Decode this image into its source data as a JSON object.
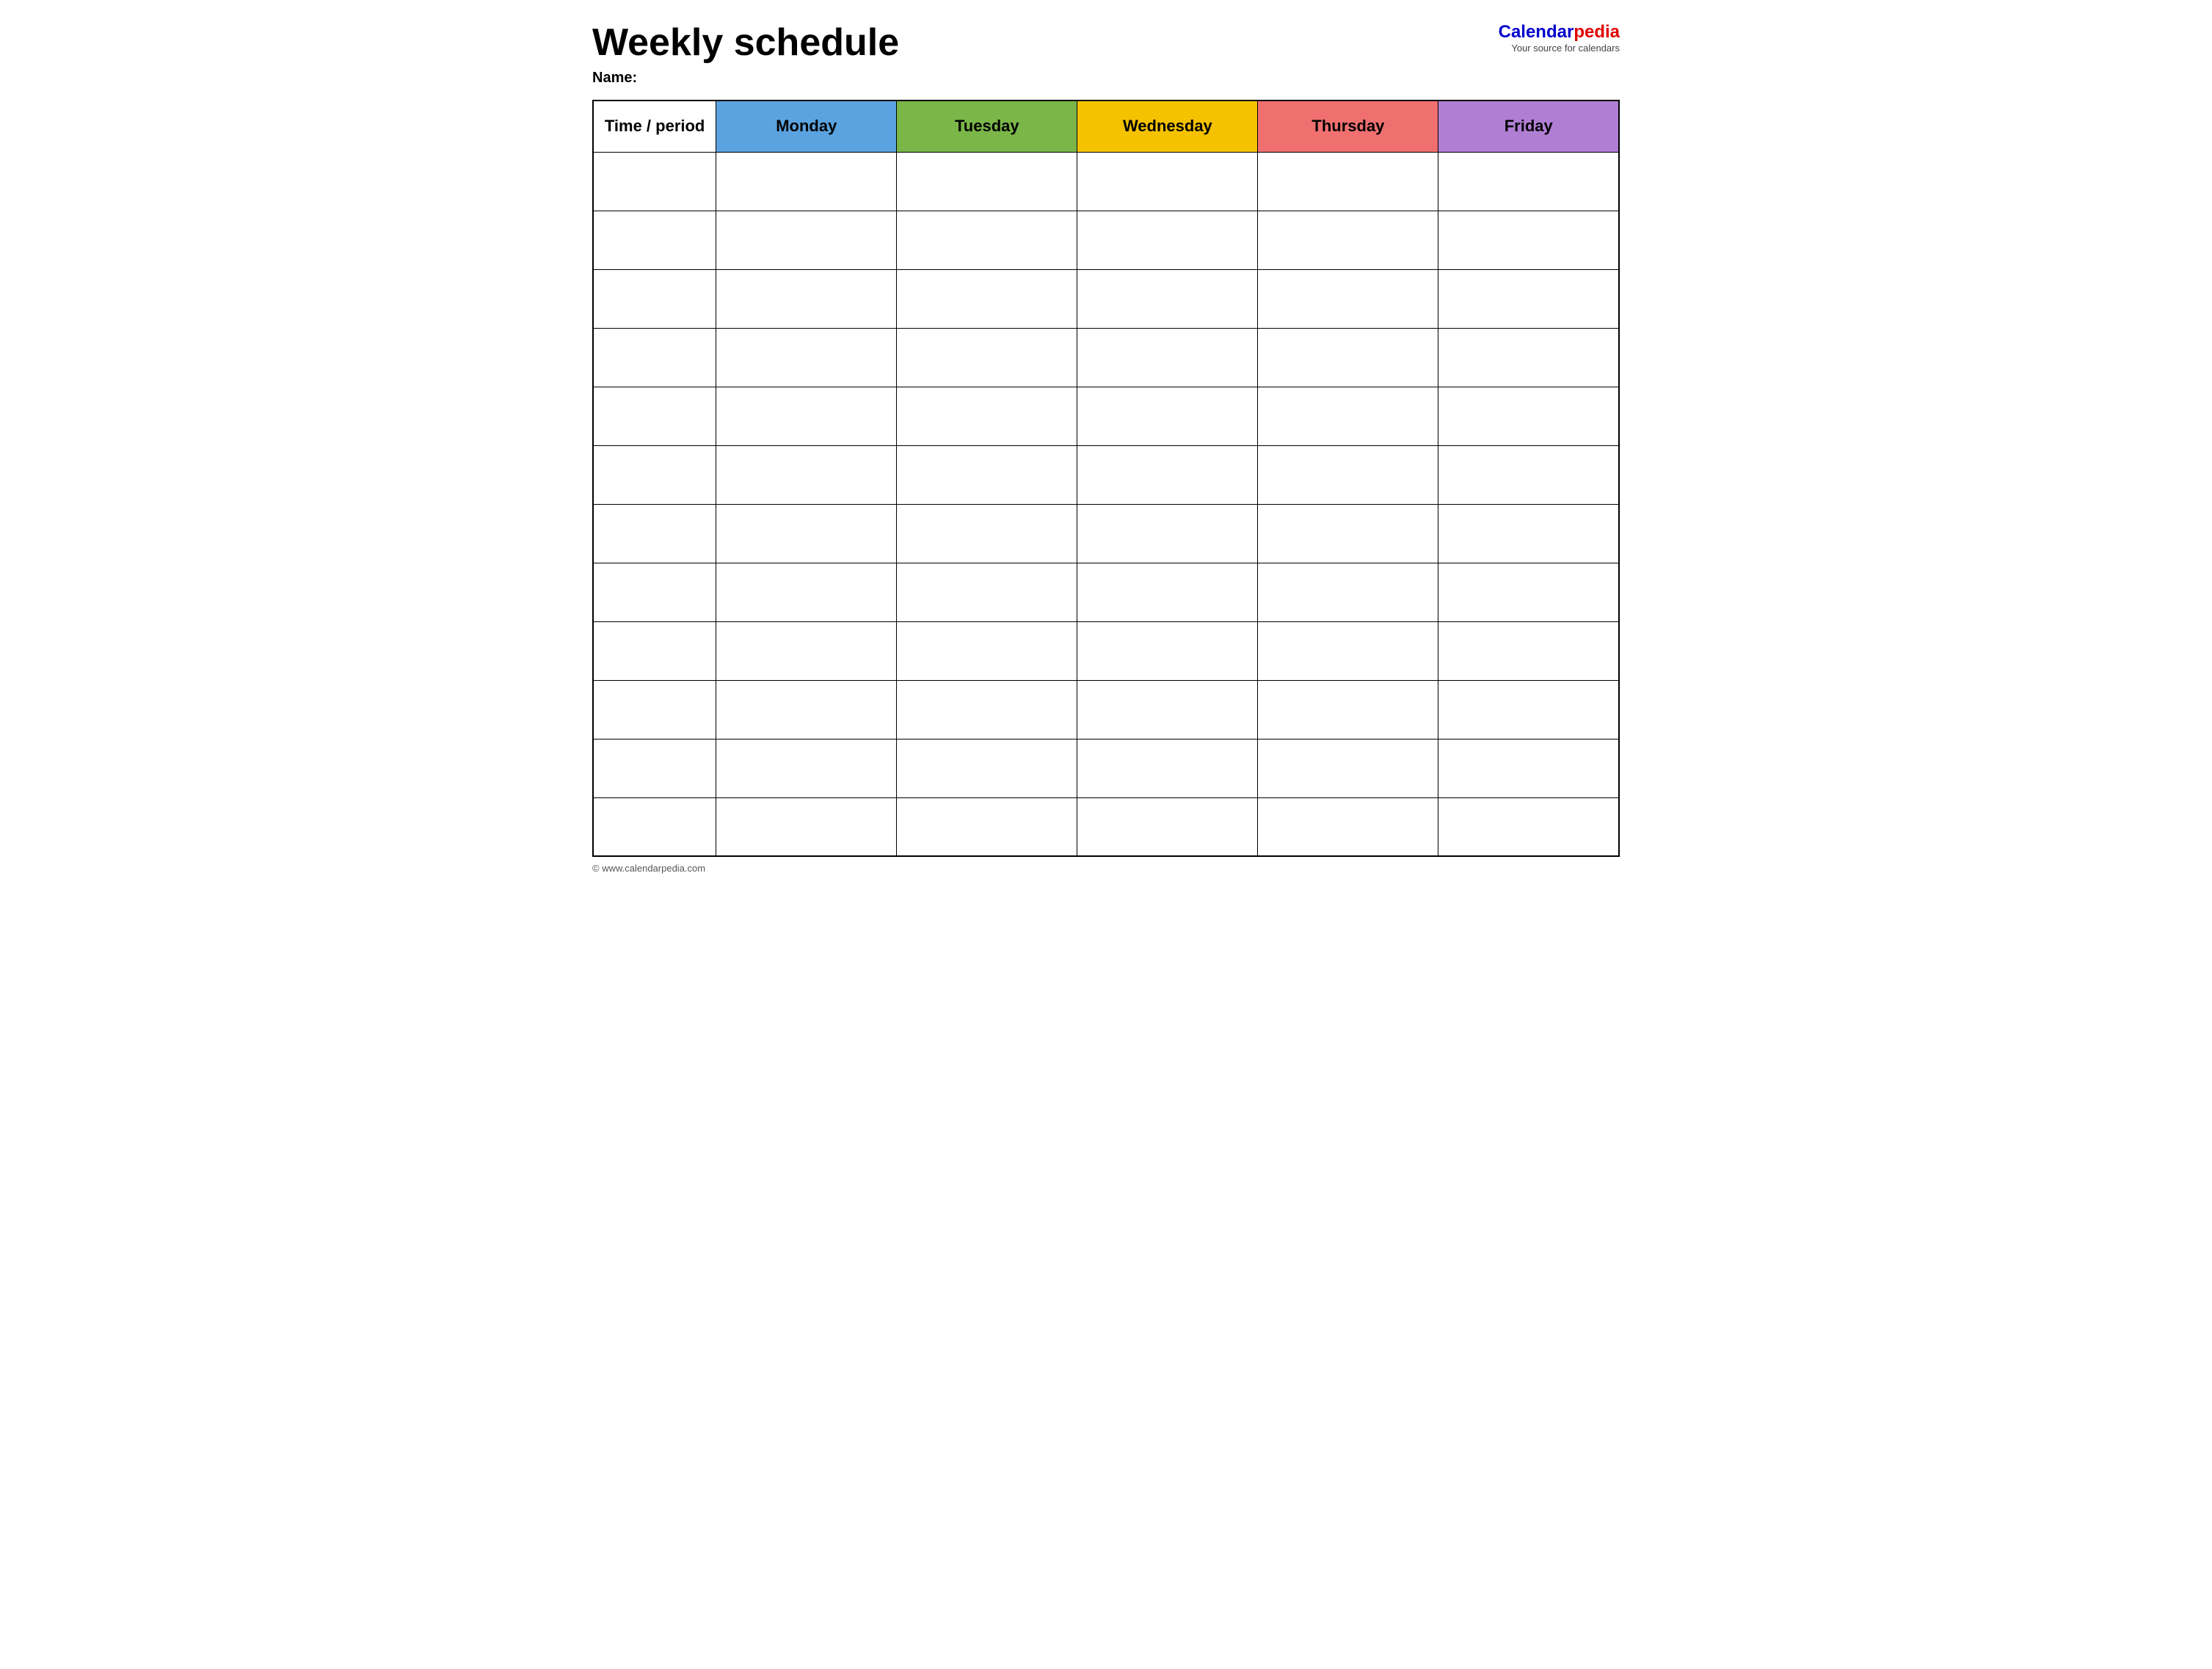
{
  "header": {
    "title": "Weekly schedule",
    "name_label": "Name:",
    "logo_calendar": "Calendar",
    "logo_pedia": "pedia",
    "logo_tagline": "Your source for calendars"
  },
  "table": {
    "columns": [
      {
        "id": "time",
        "label": "Time / period",
        "color": "#ffffff"
      },
      {
        "id": "monday",
        "label": "Monday",
        "color": "#5ba3e0"
      },
      {
        "id": "tuesday",
        "label": "Tuesday",
        "color": "#7ab648"
      },
      {
        "id": "wednesday",
        "label": "Wednesday",
        "color": "#f5c200"
      },
      {
        "id": "thursday",
        "label": "Thursday",
        "color": "#f07070"
      },
      {
        "id": "friday",
        "label": "Friday",
        "color": "#b07fd4"
      }
    ],
    "rows": 12
  },
  "footer": {
    "url": "© www.calendarpedia.com"
  }
}
